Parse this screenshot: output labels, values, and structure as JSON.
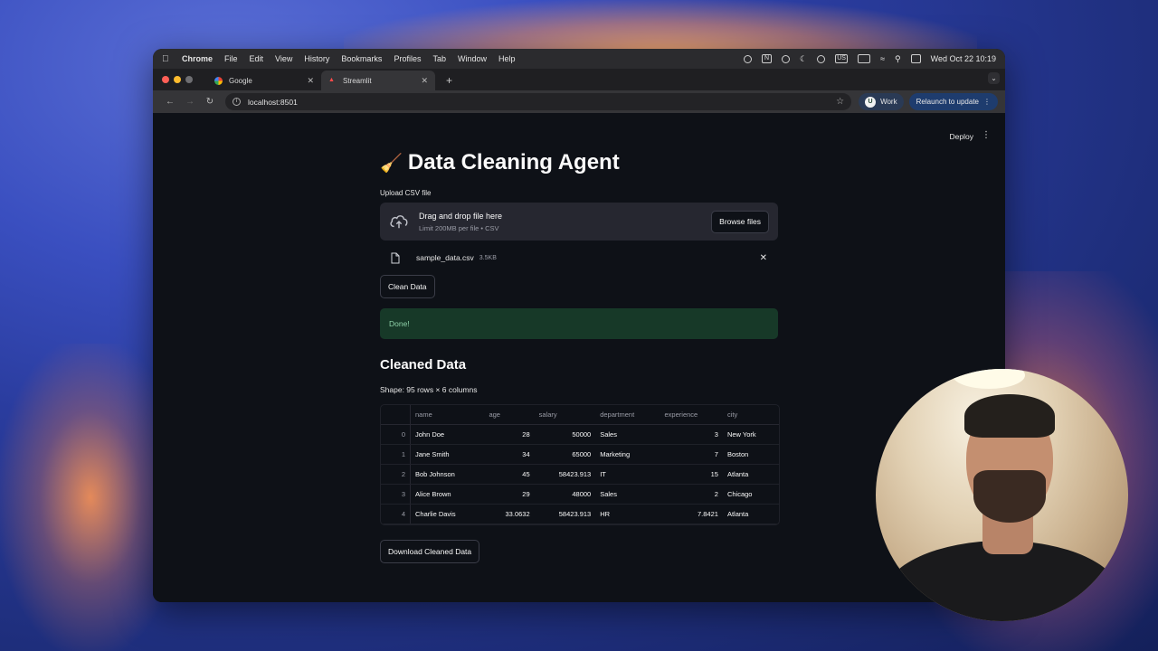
{
  "menubar": {
    "app": "Chrome",
    "items": [
      "File",
      "Edit",
      "View",
      "History",
      "Bookmarks",
      "Profiles",
      "Tab",
      "Window",
      "Help"
    ],
    "clock": "Wed Oct 22  10:19",
    "status_input": "US",
    "status_battery": "N"
  },
  "tabs": [
    {
      "label": "Google"
    },
    {
      "label": "Streamlit"
    }
  ],
  "toolbar": {
    "url": "localhost:8501",
    "profile": "Work",
    "relaunch": "Relaunch to update"
  },
  "app": {
    "deploy": "Deploy",
    "title": "Data Cleaning Agent",
    "upload_label": "Upload CSV file",
    "drop_text": "Drag and drop file here",
    "drop_limit": "Limit 200MB per file • CSV",
    "browse": "Browse files",
    "file_name": "sample_data.csv",
    "file_size": "3.5KB",
    "clean_button": "Clean Data",
    "success": "Done!",
    "cleaned_heading": "Cleaned Data",
    "shape": "Shape: 95 rows × 6 columns",
    "download_button": "Download Cleaned Data",
    "table": {
      "columns": [
        "name",
        "age",
        "salary",
        "department",
        "experience",
        "city"
      ],
      "rows": [
        [
          "0",
          "John Doe",
          "28",
          "50000",
          "Sales",
          "3",
          "New York"
        ],
        [
          "1",
          "Jane Smith",
          "34",
          "65000",
          "Marketing",
          "7",
          "Boston"
        ],
        [
          "2",
          "Bob Johnson",
          "45",
          "58423.913",
          "IT",
          "15",
          "Atlanta"
        ],
        [
          "3",
          "Alice Brown",
          "29",
          "48000",
          "Sales",
          "2",
          "Chicago"
        ],
        [
          "4",
          "Charlie Davis",
          "33.0632",
          "58423.913",
          "HR",
          "7.8421",
          "Atlanta"
        ]
      ]
    }
  },
  "colors": {
    "app_bg": "#0e1117",
    "success_bg": "#173928",
    "success_text": "#8ed1a8"
  }
}
